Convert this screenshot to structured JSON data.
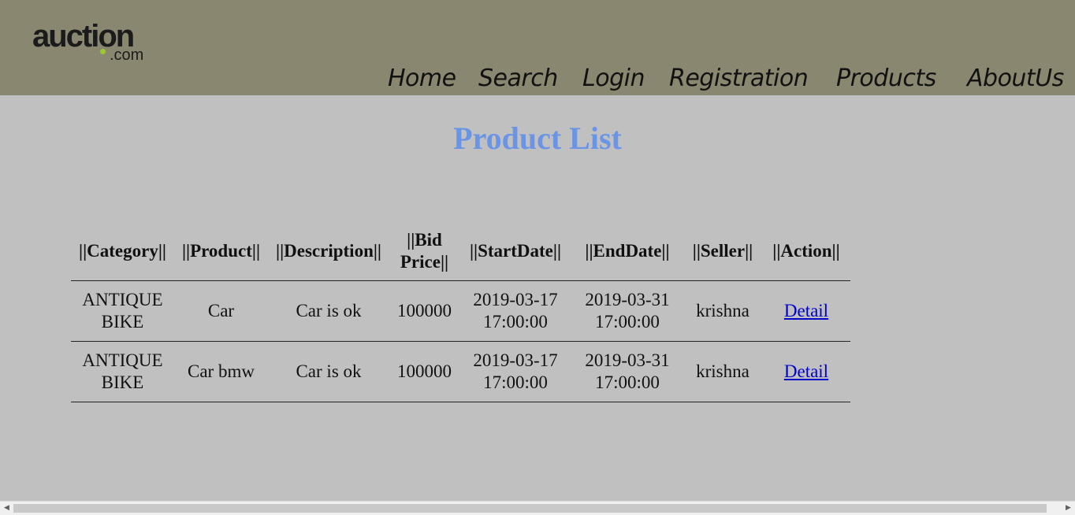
{
  "logo": {
    "main_a": "auct",
    "bang": "i",
    "main_b": "on",
    "sub": ".com"
  },
  "nav": [
    "Home",
    "Search",
    "Login",
    "Registration",
    "Products",
    "AboutUs"
  ],
  "title": "Product List",
  "table": {
    "headers": [
      "||Category||",
      "||Product||",
      "||Description||",
      "||Bid Price||",
      "||StartDate||",
      "||EndDate||",
      "||Seller||",
      "||Action||"
    ],
    "rows": [
      [
        "ANTIQUE BIKE",
        "Car",
        "Car is ok",
        "100000",
        "2019-03-17 17:00:00",
        "2019-03-31 17:00:00",
        "krishna",
        "Detail"
      ],
      [
        "ANTIQUE BIKE",
        "Car bmw",
        "Car is ok",
        "100000",
        "2019-03-17 17:00:00",
        "2019-03-31 17:00:00",
        "krishna",
        "Detail"
      ]
    ]
  },
  "scrollbar": {
    "left_arrow": "◀",
    "right_arrow": "▶"
  },
  "colors": {
    "header_bg": "#8a8770",
    "page_bg": "#c0c0c0",
    "title": "#6a94e6",
    "link": "#0000cc",
    "logo_accent": "#9cc92b"
  }
}
